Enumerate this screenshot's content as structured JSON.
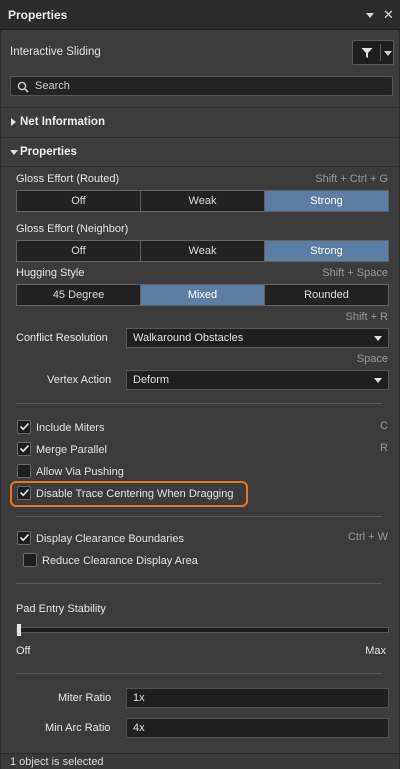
{
  "window": {
    "title": "Properties",
    "pin_icon": "dropdown-pin-icon",
    "close_icon": "close-icon"
  },
  "header": {
    "mode_label": "Interactive Sliding",
    "filter_icon": "filter-icon"
  },
  "search": {
    "placeholder": "Search",
    "value": ""
  },
  "sections": {
    "net_information": "Net Information",
    "properties": "Properties"
  },
  "gloss_routed": {
    "label": "Gloss Effort (Routed)",
    "hotkey": "Shift + Ctrl + G",
    "options": [
      "Off",
      "Weak",
      "Strong"
    ],
    "selected": "Strong"
  },
  "gloss_neighbor": {
    "label": "Gloss Effort (Neighbor)",
    "options": [
      "Off",
      "Weak",
      "Strong"
    ],
    "selected": "Strong"
  },
  "hugging": {
    "label": "Hugging Style",
    "hotkey": "Shift + Space",
    "options": [
      "45 Degree",
      "Mixed",
      "Rounded"
    ],
    "selected": "Mixed"
  },
  "conflict": {
    "hotkey": "Shift + R",
    "label": "Conflict Resolution",
    "value": "Walkaround Obstacles"
  },
  "vertex": {
    "hotkey": "Space",
    "label": "Vertex Action",
    "value": "Deform"
  },
  "checkboxes": {
    "include_miters": {
      "label": "Include Miters",
      "checked": true,
      "hotkey": "C"
    },
    "merge_parallel": {
      "label": "Merge Parallel",
      "checked": true,
      "hotkey": "R"
    },
    "allow_via_pushing": {
      "label": "Allow Via Pushing",
      "checked": false
    },
    "disable_trace_centering": {
      "label": "Disable Trace Centering When Dragging",
      "checked": true
    },
    "display_clearance": {
      "label": "Display Clearance Boundaries",
      "checked": true,
      "hotkey": "Ctrl + W"
    },
    "reduce_clearance": {
      "label": "Reduce Clearance Display Area",
      "checked": false
    }
  },
  "pad_entry": {
    "label": "Pad Entry Stability",
    "min_label": "Off",
    "max_label": "Max",
    "value_fraction": 0.0
  },
  "miter_ratio": {
    "label": "Miter Ratio",
    "value": "1x"
  },
  "min_arc_ratio": {
    "label": "Min Arc Ratio",
    "value": "4x"
  },
  "status": {
    "text": "1 object is selected"
  },
  "colors": {
    "accent": "#5c7ea5",
    "highlight": "#e8781c",
    "panel_bg": "#3c3c3c",
    "title_bg": "#2b2b2b"
  }
}
